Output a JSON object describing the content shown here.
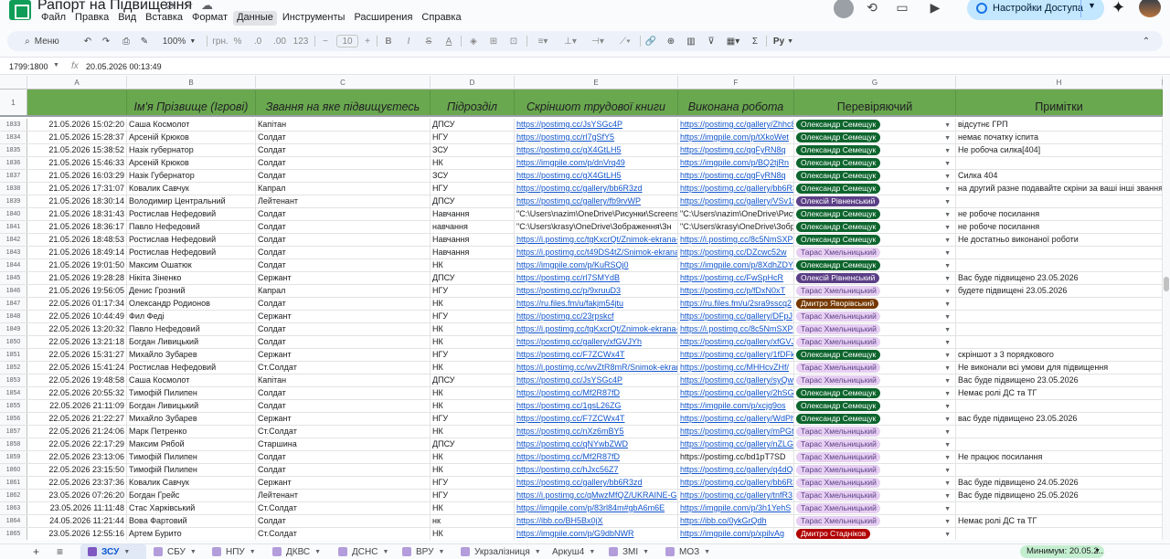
{
  "app": {
    "title": "Рапорт на Підвищення",
    "icons": [
      "move-to-folder-icon",
      "star-icon",
      "cloud-status-icon"
    ]
  },
  "menu": [
    {
      "label": "Файл",
      "active": false
    },
    {
      "label": "Правка",
      "active": false
    },
    {
      "label": "Вид",
      "active": false
    },
    {
      "label": "Вставка",
      "active": false
    },
    {
      "label": "Формат",
      "active": false
    },
    {
      "label": "Данные",
      "active": true
    },
    {
      "label": "Инструменты",
      "active": false
    },
    {
      "label": "Расширения",
      "active": false
    },
    {
      "label": "Справка",
      "active": false
    }
  ],
  "share": {
    "label": "Настройки Доступа"
  },
  "toolbar": {
    "menu_label": "Меню",
    "zoom": "100%",
    "currency": "грн.",
    "percent": "%",
    "dec_dec": ".0",
    "dec_inc": ".00",
    "num_format": "123",
    "font_size": "10",
    "function_label": "Ру"
  },
  "formula": {
    "namebox": "1799:1800",
    "value": "20.05.2026 00:13:49"
  },
  "columns": [
    "A",
    "B",
    "C",
    "D",
    "E",
    "F",
    "G",
    "H",
    "I"
  ],
  "header_row": {
    "num": "1",
    "cells": [
      "",
      "Ім'я Прізвище (Ігрові)",
      "Звання на яке підвищуєтесь",
      "Підрозділ",
      "Скріншот трудової книги",
      "Виконана робота",
      "Перевіряючий",
      "Примітки"
    ]
  },
  "chip_colors": {
    "semeshchuk": "#0d652d",
    "rivnenskyi": "#5b3f86",
    "khmelnytskyi": "#e6cff2",
    "yavorivskyi": "#753800",
    "stadnikov": "#b10202"
  },
  "rows": [
    {
      "num": "1833",
      "ts": "21.05.2026 15:02:20",
      "name": "Саша Космолот",
      "rank": "Капітан",
      "unit": "ДПСУ",
      "screenshot": "https://postimg.cc/JsYSGc4P",
      "work": "https://postimg.cc/gallery/Zhhc8",
      "checker": "Олександр Семещук",
      "chip": "semeshchuk",
      "note": "відсутнє ГРП"
    },
    {
      "num": "1834",
      "ts": "21.05.2026 15:28:37",
      "name": "Арсеній Крюков",
      "rank": "Солдат",
      "unit": "НГУ",
      "screenshot": "https://postimg.cc/rl7gSfY5",
      "work": "https://imgpile.com/p/tXkoWet",
      "checker": "Олександр Семещук",
      "chip": "semeshchuk",
      "note": "немає початку іспита"
    },
    {
      "num": "1835",
      "ts": "21.05.2026 15:38:52",
      "name": "Назік губернатор",
      "rank": "Солдат",
      "unit": "ЗСУ",
      "screenshot": "https://postimg.cc/gX4GtLH5",
      "work": "https://postimg.cc/qgFyRN8q",
      "checker": "Олександр Семещук",
      "chip": "semeshchuk",
      "note": "Не робоча силка[404]"
    },
    {
      "num": "1836",
      "ts": "21.05.2026 15:46:33",
      "name": "Арсеній Крюков",
      "rank": "Солдат",
      "unit": "НК",
      "screenshot": "https://imgpile.com/p/dnVrq49",
      "work": "https://imgpile.com/p/BQ2tjRn",
      "checker": "Олександр Семещук",
      "chip": "semeshchuk",
      "note": ""
    },
    {
      "num": "1837",
      "ts": "21.05.2026 16:03:29",
      "name": "Назік Губернатор",
      "rank": "Солдат",
      "unit": "ЗСУ",
      "screenshot": "https://postimg.cc/gX4GtLH5",
      "work": "https://postimg.cc/qgFyRN8q",
      "checker": "Олександр Семещук",
      "chip": "semeshchuk",
      "note": "Силка 404"
    },
    {
      "num": "1838",
      "ts": "21.05.2026 17:31:07",
      "name": "Ковалик Савчук",
      "rank": "Капрал",
      "unit": "НГУ",
      "screenshot": "https://postimg.cc/gallery/bb6R3zd",
      "work": "https://postimg.cc/gallery/bb6R3",
      "checker": "Олександр Семещук",
      "chip": "semeshchuk",
      "note": "на другий разне подавайте скріни за ваші інші звання"
    },
    {
      "num": "1839",
      "ts": "21.05.2026 18:30:14",
      "name": "Володимир Центральний",
      "rank": "Лейтенант",
      "unit": "ДПСУ",
      "screenshot": "https://postimg.cc/gallery/fb9rvWP",
      "work": "https://postimg.cc/gallery/VSv1f",
      "checker": "Олексій Рівненський",
      "chip": "rivnenskyi",
      "note": ""
    },
    {
      "num": "1840",
      "ts": "21.05.2026 18:31:43",
      "name": "Ростислав Нефедовий",
      "rank": "Солдат",
      "unit": "Навчання",
      "screenshot": "\"C:\\Users\\nazim\\OneDrive\\Рисунки\\Screens",
      "work": "\"C:\\Users\\nazim\\OneDrive\\Рису",
      "checker": "Олександр Семещук",
      "chip": "semeshchuk",
      "note": "не робоче посилання",
      "plain": true
    },
    {
      "num": "1841",
      "ts": "21.05.2026 18:36:17",
      "name": "Павло Нефедовий",
      "rank": "Солдат",
      "unit": "навчання",
      "screenshot": "\"C:\\Users\\krasy\\OneDrive\\Зображення\\Зн",
      "work": "\"C:\\Users\\krasy\\OneDrive\\Зобр",
      "checker": "Олександр Семещук",
      "chip": "semeshchuk",
      "note": "не робоче посилання",
      "plain": true
    },
    {
      "num": "1842",
      "ts": "21.05.2026 18:48:53",
      "name": "Ростислав Нефедовий",
      "rank": "Солдат",
      "unit": "Навчання",
      "screenshot": "https://i.postimg.cc/tgKxcrQt/Znimok-ekrana-",
      "work": "https://i.postimg.cc/8c5NmSXP",
      "checker": "Олександр Семещук",
      "chip": "semeshchuk",
      "note": "Не достатньо виконаної роботи"
    },
    {
      "num": "1843",
      "ts": "21.05.2026 18:49:14",
      "name": "Ростислав Нефедовий",
      "rank": "Солдат",
      "unit": "Навчання",
      "screenshot": "https://i.postimg.cc/t49DS4tZ/Snimok-ekrana",
      "work": "https://postimg.cc/DZcwc52w",
      "checker": "Тарас Хмельницький",
      "chip": "khmelnytskyi",
      "note": ""
    },
    {
      "num": "1844",
      "ts": "21.05.2026 19:01:50",
      "name": "Максим Ошатюк",
      "rank": "Солдат",
      "unit": "НК",
      "screenshot": "https://imgpile.com/p/KuRSQj0",
      "work": "https://imgpile.com/p/8XdhZDY",
      "checker": "Олександр Семещук",
      "chip": "semeshchuk",
      "note": ""
    },
    {
      "num": "1845",
      "ts": "21.05.2026 19:28:28",
      "name": "Нікіта Зіненко",
      "rank": "Сержант",
      "unit": "ДПСУ",
      "screenshot": "https://postimg.cc/rl7SMYdB",
      "work": "https://postimg.cc/FwSpHcR",
      "checker": "Олексій Рівненський",
      "chip": "rivnenskyi",
      "note": "Вас буде підвищено 23.05.2026"
    },
    {
      "num": "1846",
      "ts": "21.05.2026 19:56:05",
      "name": "Денис Грозний",
      "rank": "Капрал",
      "unit": "НГУ",
      "screenshot": "https://postimg.cc/p/9xruuD3",
      "work": "https://postimg.cc/p/fDxN0xT",
      "checker": "Тарас Хмельницький",
      "chip": "khmelnytskyi",
      "note": "будете підвищені 23.05.2026"
    },
    {
      "num": "1847",
      "ts": "22.05.2026 01:17:34",
      "name": "Олександр Родионов",
      "rank": "Солдат",
      "unit": "НК",
      "screenshot": "https://ru.files.fm/u/fakjm54jtu",
      "work": "https://ru.files.fm/u/2sra9sscq2",
      "checker": "Дмитро Яворівський",
      "chip": "yavorivskyi",
      "note": ""
    },
    {
      "num": "1848",
      "ts": "22.05.2026 10:44:49",
      "name": "Фил Феді",
      "rank": "Сержант",
      "unit": "НГУ",
      "screenshot": "https://postimg.cc/23rpskcf",
      "work": "https://postimg.cc/gallery/DFpJ",
      "checker": "Тарас Хмельницький",
      "chip": "khmelnytskyi",
      "note": ""
    },
    {
      "num": "1849",
      "ts": "22.05.2026 13:20:32",
      "name": "Павло Нефедовий",
      "rank": "Солдат",
      "unit": "НК",
      "screenshot": "https://i.postimg.cc/tgKxcrQt/Znimok-ekrana-",
      "work": "https://i.postimg.cc/8c5NmSXP",
      "checker": "Тарас Хмельницький",
      "chip": "khmelnytskyi",
      "note": ""
    },
    {
      "num": "1850",
      "ts": "22.05.2026 13:21:18",
      "name": "Богдан Ливицький",
      "rank": "Солдат",
      "unit": "НК",
      "screenshot": "https://postimg.cc/gallery/xfGVJYh",
      "work": "https://postimg.cc/gallery/xfGVJ",
      "checker": "Тарас Хмельницький",
      "chip": "khmelnytskyi",
      "note": ""
    },
    {
      "num": "1851",
      "ts": "22.05.2026 15:31:27",
      "name": "Михайло Зубарев",
      "rank": "Сержант",
      "unit": "НГУ",
      "screenshot": "https://postimg.cc/F7ZCWx4T",
      "work": "https://postimg.cc/gallery/1fDFk",
      "checker": "Олександр Семещук",
      "chip": "semeshchuk",
      "note": "скріншот з 3 порядкового"
    },
    {
      "num": "1852",
      "ts": "22.05.2026 15:41:24",
      "name": "Ростислав Нефедовий",
      "rank": "Ст.Солдат",
      "unit": "НК",
      "screenshot": "https://i.postimg.cc/wvZtR8mR/Snimok-ekran",
      "work": "https://postimg.cc/MHHcvZHf/",
      "checker": "Тарас Хмельницький",
      "chip": "khmelnytskyi",
      "note": "Не виконали всі умови для підвищення"
    },
    {
      "num": "1853",
      "ts": "22.05.2026 19:48:58",
      "name": "Саша Космолот",
      "rank": "Капітан",
      "unit": "ДПСУ",
      "screenshot": "https://postimg.cc/JsYSGc4P",
      "work": "https://postimg.cc/gallery/syQwi",
      "checker": "Тарас Хмельницький",
      "chip": "khmelnytskyi",
      "note": "Вас буде підвищено 23.05.2026"
    },
    {
      "num": "1854",
      "ts": "22.05.2026 20:55:32",
      "name": "Тимофій Пилипен",
      "rank": "Солдат",
      "unit": "НК",
      "screenshot": "https://postimg.cc/Mf2R87fD",
      "work": "https://postimg.cc/gallery/2hSG",
      "checker": "Олександр Семещук",
      "chip": "semeshchuk",
      "note": "Немає ролі ДС та ТГ"
    },
    {
      "num": "1855",
      "ts": "22.05.2026 21:11:09",
      "name": "Богдан Ливицький",
      "rank": "Солдат",
      "unit": "НК",
      "screenshot": "https://postimg.cc/1gsL26ZG",
      "work": "https://imgpile.com/p/xcjg9os",
      "checker": "Олександр Семещук",
      "chip": "semeshchuk",
      "note": ""
    },
    {
      "num": "1856",
      "ts": "22.05.2026 21:22:27",
      "name": "Михайло Зубарев",
      "rank": "Сержант",
      "unit": "НГУ",
      "screenshot": "https://postimg.cc/F7ZCWx4T",
      "work": "https://postimg.cc/gallery/WdPh",
      "checker": "Олександр Семещук",
      "chip": "semeshchuk",
      "note": "вас буде підвищено 23.05.2026"
    },
    {
      "num": "1857",
      "ts": "22.05.2026 21:24:06",
      "name": "Марк Петренко",
      "rank": "Ст.Солдат",
      "unit": "НК",
      "screenshot": "https://postimg.cc/nXz6mBY5",
      "work": "https://postimg.cc/gallery/mPGt",
      "checker": "Тарас Хмельницький",
      "chip": "khmelnytskyi",
      "note": ""
    },
    {
      "num": "1858",
      "ts": "22.05.2026 22:17:29",
      "name": "Максим Рябой",
      "rank": "Старшина",
      "unit": "ДПСУ",
      "screenshot": "https://postimg.cc/qNYwbZWD",
      "work": "https://postimg.cc/gallery/nZLG",
      "checker": "Тарас Хмельницький",
      "chip": "khmelnytskyi",
      "note": ""
    },
    {
      "num": "1859",
      "ts": "22.05.2026 23:13:06",
      "name": "Тимофій Пилипен",
      "rank": "Солдат",
      "unit": "НК",
      "screenshot": "https://postimg.cc/Mf2R87fD",
      "work": "https://postimg.cc/bd1pT7SD",
      "checker": "Тарас Хмельницький",
      "chip": "khmelnytskyi",
      "note": "Не працює посилання",
      "work_plain": true
    },
    {
      "num": "1860",
      "ts": "22.05.2026 23:15:50",
      "name": "Тимофій Пилипен",
      "rank": "Солдат",
      "unit": "НК",
      "screenshot": "https://postimg.cc/hJxc56Z7",
      "work": "https://postimg.cc/gallery/q4dQ",
      "checker": "Тарас Хмельницький",
      "chip": "khmelnytskyi",
      "note": ""
    },
    {
      "num": "1861",
      "ts": "22.05.2026 23:37:36",
      "name": "Ковалик Савчук",
      "rank": "Сержант",
      "unit": "НГУ",
      "screenshot": "https://postimg.cc/gallery/bb6R3zd",
      "work": "https://postimg.cc/gallery/bb6R3",
      "checker": "Тарас Хмельницький",
      "chip": "khmelnytskyi",
      "note": "Вас буде підвищено 24.05.2026"
    },
    {
      "num": "1862",
      "ts": "23.05.2026 07:26:20",
      "name": "Богдан Грейс",
      "rank": "Лейтенант",
      "unit": "НГУ",
      "screenshot": "https://i.postimg.cc/qMwzMfQZ/UKRAINE-G",
      "work": "https://postimg.cc/gallery/tnfR3",
      "checker": "Тарас Хмельницький",
      "chip": "khmelnytskyi",
      "note": "Вас буде підвищено 25.05.2026"
    },
    {
      "num": "1863",
      "ts": "23.05.2026 11:11:48",
      "name": "Стас Харківський",
      "rank": "Ст.Солдат",
      "unit": "НК",
      "screenshot": "https://imgpile.com/p/83rl84m#gbA6m6E",
      "work": "https://imgpile.com/p/3h1YehS",
      "checker": "Тарас Хмельницький",
      "chip": "khmelnytskyi",
      "note": ""
    },
    {
      "num": "1864",
      "ts": "24.05.2026 11:21:44",
      "name": "Вова Фартовий",
      "rank": "Солдат",
      "unit": "нк",
      "screenshot": "https://ibb.co/BH5Bx0jX",
      "work": "https://ibb.co/0ykGrQdh",
      "checker": "Тарас Хмельницький",
      "chip": "khmelnytskyi",
      "note": "Немає ролі ДС та ТГ"
    },
    {
      "num": "1865",
      "ts": "23.05.2026 12:55:16",
      "name": "Артем Бурито",
      "rank": "Ст.Солдат",
      "unit": "НК",
      "screenshot": "https://imgpile.com/p/G9dbNWR",
      "work": "https://imgpile.com/p/xpilvAg",
      "checker": "Дмитро Стадніков",
      "chip": "stadnikov",
      "note": ""
    }
  ],
  "sheets": [
    {
      "label": "ЗСУ",
      "active": true,
      "color": "#7e57c2"
    },
    {
      "label": "СБУ",
      "active": false,
      "color": "#b39ddb"
    },
    {
      "label": "НПУ",
      "active": false,
      "color": "#b39ddb"
    },
    {
      "label": "ДКВС",
      "active": false,
      "color": "#b39ddb"
    },
    {
      "label": "ДСНС",
      "active": false,
      "color": "#b39ddb"
    },
    {
      "label": "ВРУ",
      "active": false,
      "color": "#b39ddb"
    },
    {
      "label": "Укрзалізниця",
      "active": false,
      "color": "#b39ddb"
    },
    {
      "label": "Аркуш4",
      "active": false,
      "color": ""
    },
    {
      "label": "ЗМІ",
      "active": false,
      "color": "#b39ddb"
    },
    {
      "label": "МОЗ",
      "active": false,
      "color": "#b39ddb"
    }
  ],
  "summary": {
    "label": "Минимум: 20.05.2..."
  }
}
